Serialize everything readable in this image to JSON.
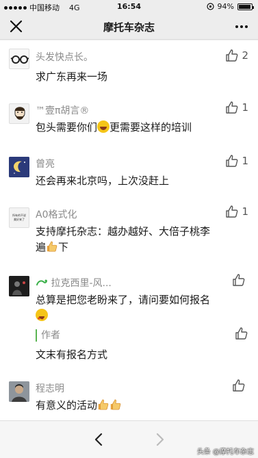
{
  "status_bar": {
    "carrier": "中国移动",
    "network": "4G",
    "time": "16:54",
    "battery_text": "94%",
    "battery_level": 0.94
  },
  "nav": {
    "title": "摩托车杂志",
    "close_icon": "close-icon",
    "more_icon": "more-icon"
  },
  "comments": [
    {
      "nickname": "头发快点长。",
      "text": "求广东再来一场",
      "likes": "2"
    },
    {
      "nickname": "™壹π胡言®",
      "text_before": "包头需要你们",
      "text_after": "更需要这样的培训",
      "emoji": "laughing-emoji",
      "likes": "1"
    },
    {
      "nickname": "曾亮",
      "text": "还会再来北京吗，上次没赶上",
      "likes": "1"
    },
    {
      "nickname": "A0格式化",
      "text_line1": "支持摩托杂志：越办越好、大倍子桃李",
      "text_line2_before": "遍",
      "text_line2_after": "下",
      "emoji": "thumbs-up-emoji",
      "likes": "1",
      "avatar_text": "所有的不说 美好来了"
    },
    {
      "nickname": "拉克西里-风...",
      "text_line1": "总算是把您老盼来了，请问要如何报名",
      "emoji": "star-eyes-emoji",
      "likes": "",
      "reply": {
        "author": "作者",
        "text": "文末有报名方式"
      }
    },
    {
      "nickname": "程志明",
      "text": "有意义的活动",
      "emoji": "thumbs-up-emoji",
      "likes": ""
    }
  ],
  "bottom": {
    "back_icon": "chevron-left-icon",
    "forward_icon": "chevron-right-icon",
    "watermark": "头条 @摩托车杂志"
  },
  "colors": {
    "background": "#ededed",
    "panel": "#ffffff",
    "nickname": "#8a8a8a",
    "reply_accent": "#5ab552"
  }
}
